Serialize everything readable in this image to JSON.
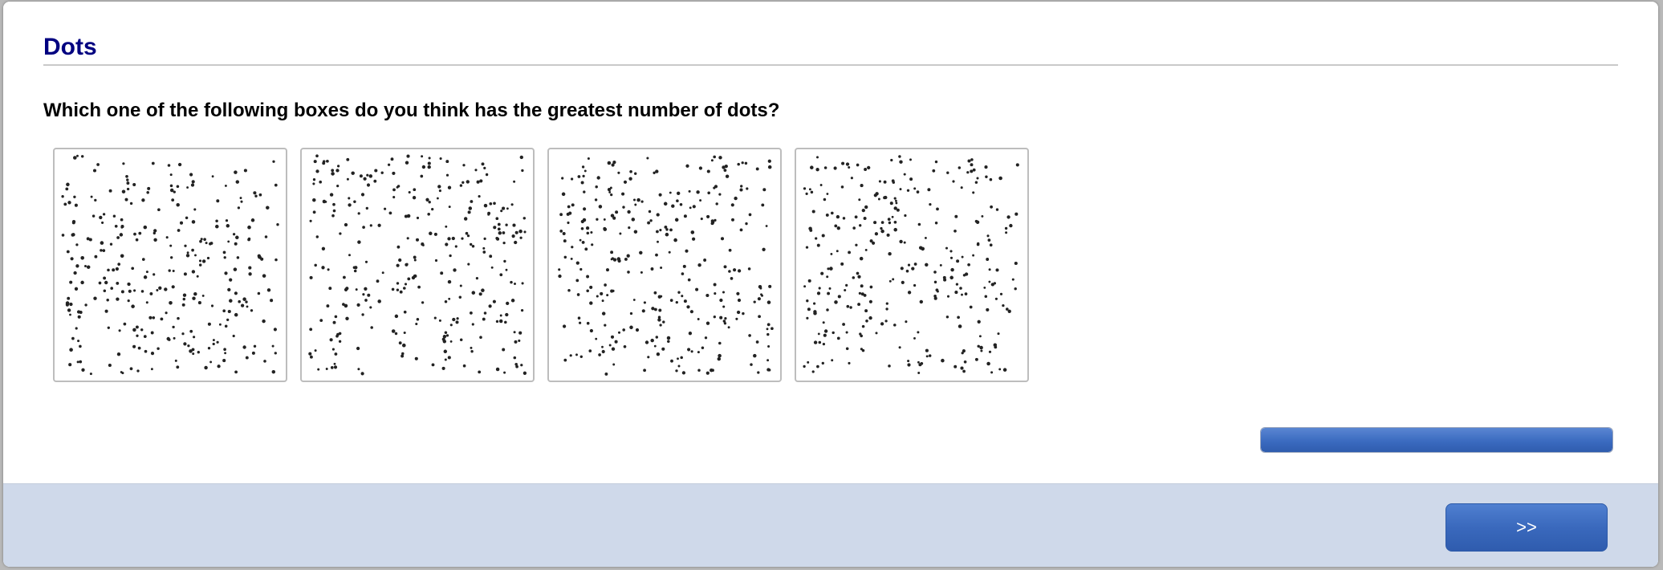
{
  "page": {
    "title": "Dots",
    "question": "Which one of the following boxes do you think has the greatest number of dots?"
  },
  "boxes": [
    {
      "seed": 11,
      "count": 300
    },
    {
      "seed": 27,
      "count": 300
    },
    {
      "seed": 43,
      "count": 305
    },
    {
      "seed": 59,
      "count": 295
    }
  ],
  "progress": {
    "fraction": 1.0
  },
  "footer": {
    "next_label": ">>"
  },
  "colors": {
    "title": "#000080",
    "accent": "#3a69bd",
    "footer_bg": "#cfd9ea",
    "dot": "#222222"
  }
}
